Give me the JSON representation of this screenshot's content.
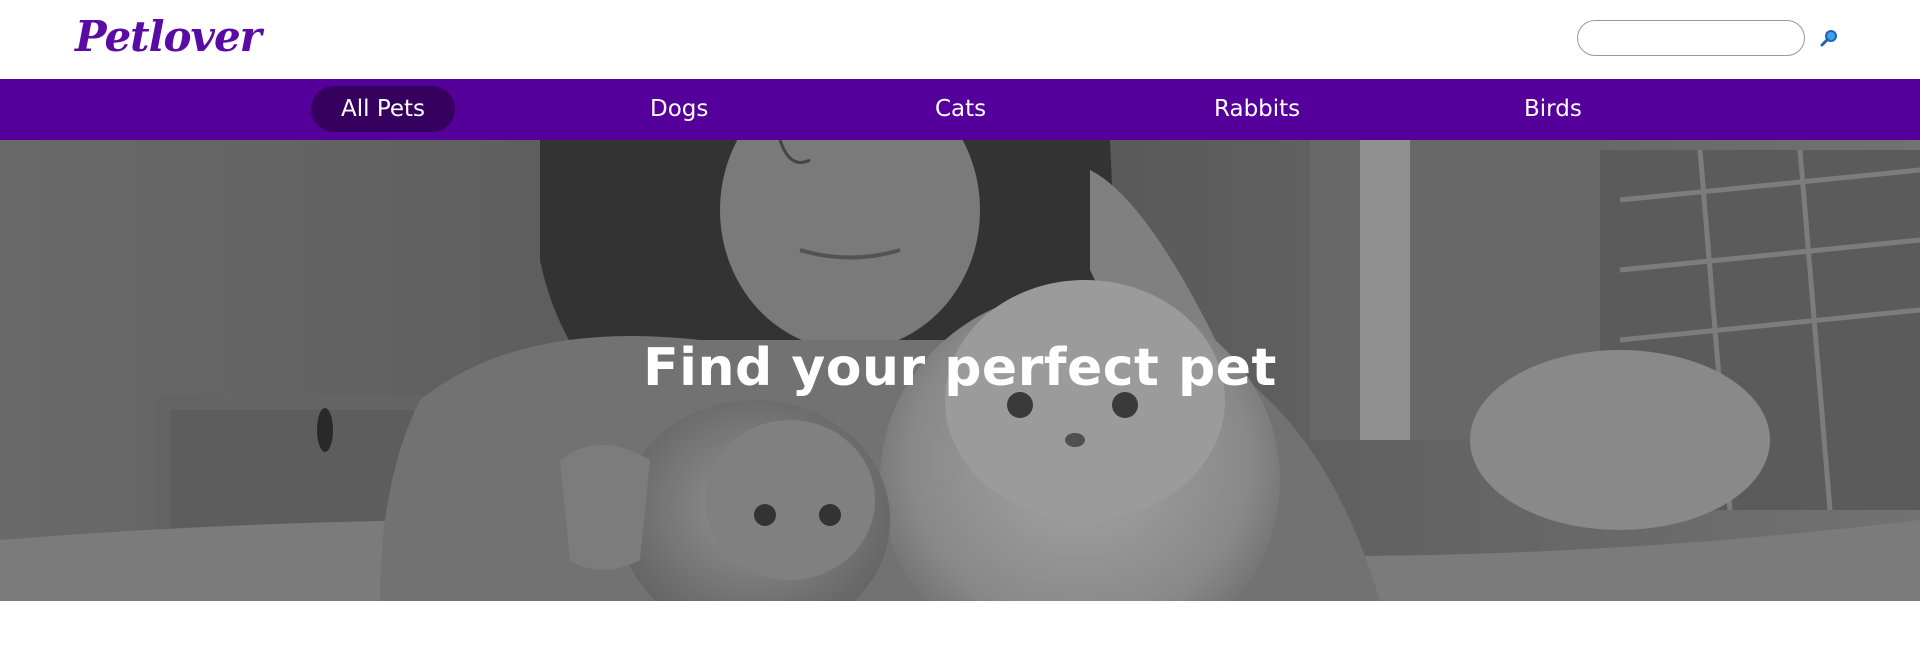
{
  "header": {
    "logo": "Petlover",
    "search": {
      "placeholder": "",
      "value": ""
    },
    "search_button_icon": "search-icon"
  },
  "nav": {
    "items": [
      {
        "label": "All Pets",
        "active": true
      },
      {
        "label": "Dogs",
        "active": false
      },
      {
        "label": "Cats",
        "active": false
      },
      {
        "label": "Rabbits",
        "active": false
      },
      {
        "label": "Birds",
        "active": false
      }
    ]
  },
  "hero": {
    "title": "Find your perfect pet",
    "image": "grayscale photo of a girl with two cats"
  },
  "colors": {
    "brand": "#5a0aa5",
    "nav_background": "#55009b",
    "nav_active": "#36005f",
    "search_icon": "#1e78d2"
  }
}
